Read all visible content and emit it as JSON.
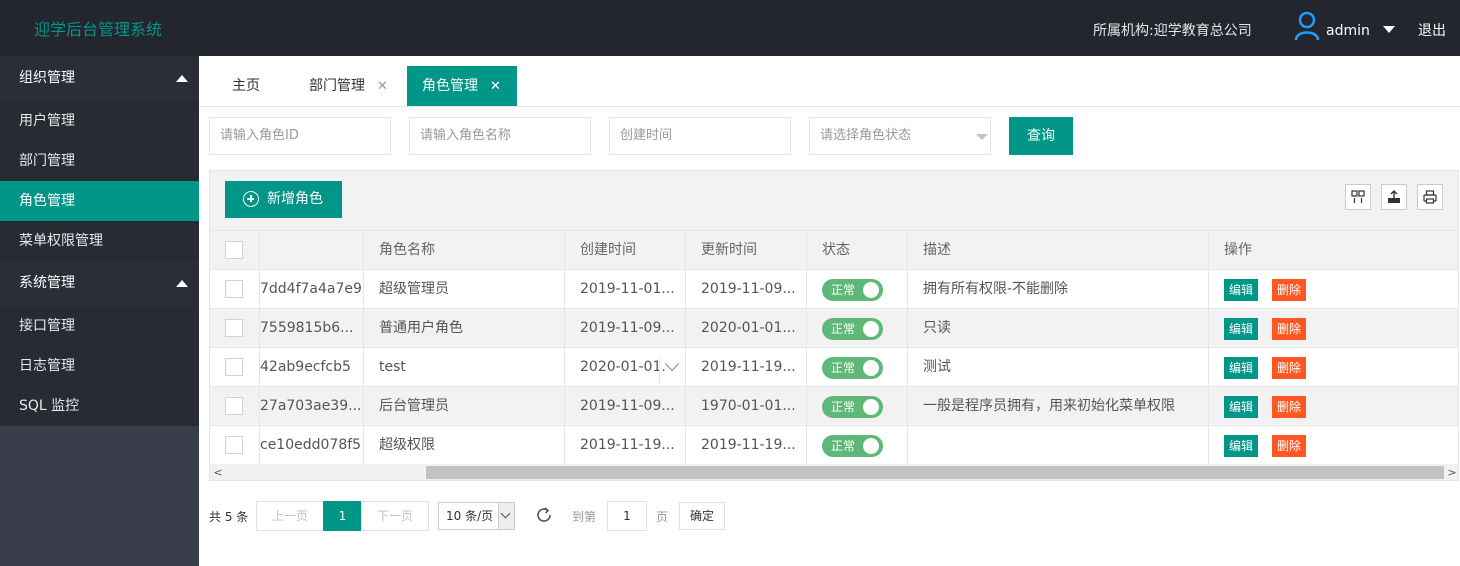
{
  "app": {
    "title": "迎学后台管理系统",
    "org_label": "所属机构:迎学教育总公司",
    "username": "admin",
    "logout_label": "退出"
  },
  "sidebar": {
    "groups": [
      {
        "label": "组织管理",
        "items": [
          "用户管理",
          "部门管理",
          "角色管理",
          "菜单权限管理"
        ]
      },
      {
        "label": "系统管理",
        "items": [
          "接口管理",
          "日志管理",
          "SQL 监控"
        ]
      }
    ],
    "active_item": "角色管理"
  },
  "tabs": [
    {
      "label": "主页",
      "closable": false
    },
    {
      "label": "部门管理",
      "closable": true
    },
    {
      "label": "角色管理",
      "closable": true,
      "active": true
    }
  ],
  "close_glyph": "✕",
  "search": {
    "role_id_placeholder": "请输入角色ID",
    "role_name_placeholder": "请输入角色名称",
    "created_time_placeholder": "创建时间",
    "status_placeholder": "请选择角色状态",
    "query_label": "查询"
  },
  "toolbar": {
    "add_label": "新增角色",
    "icons": [
      "columns-icon",
      "export-icon",
      "print-icon"
    ]
  },
  "table": {
    "columns": [
      "",
      "",
      "角色名称",
      "创建时间",
      "更新时间",
      "状态",
      "描述",
      "操作"
    ],
    "status_label": "正常",
    "edit_label": "编辑",
    "delete_label": "删除",
    "rows": [
      {
        "id": "7dd4f7a4a7e9",
        "name": "超级管理员",
        "created": "2019-11-01...",
        "updated": "2019-11-09...",
        "desc": "拥有所有权限-不能删除"
      },
      {
        "id": "7559815b6...",
        "name": "普通用户角色",
        "created": "2019-11-09...",
        "updated": "2020-01-01...",
        "desc": "只读"
      },
      {
        "id": "42ab9ecfcb5",
        "name": "test",
        "created": "2020-01-01.",
        "updated": "2019-11-19...",
        "desc": "测试"
      },
      {
        "id": "27a703ae39...",
        "name": "后台管理员",
        "created": "2019-11-09...",
        "updated": "1970-01-01...",
        "desc": "一般是程序员拥有，用来初始化菜单权限"
      },
      {
        "id": "ce10edd078f5",
        "name": "超级权限",
        "created": "2019-11-19...",
        "updated": "2019-11-19...",
        "desc": ""
      }
    ]
  },
  "pagination": {
    "total_label": "共 5 条",
    "prev_label": "上一页",
    "current_page": "1",
    "next_label": "下一页",
    "page_size_label": "10 条/页",
    "goto_label": "到第",
    "goto_value": "1",
    "page_unit": "页",
    "confirm_label": "确定"
  },
  "colors": {
    "accent": "#009688",
    "danger": "#ff5722",
    "switch_on": "#5fb878",
    "header_bg": "#23262e",
    "sidebar_bg": "#393d49"
  }
}
